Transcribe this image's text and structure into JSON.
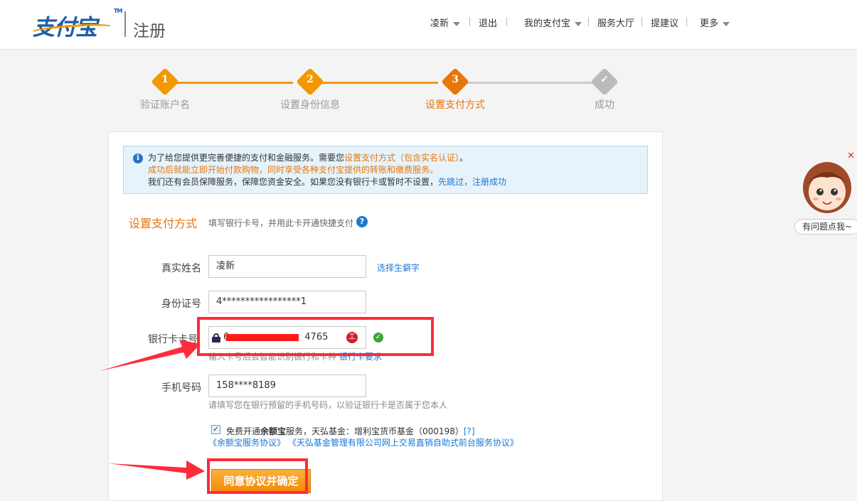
{
  "header": {
    "logo_text": "支付宝",
    "logo_tm": "TM",
    "page_title": "注册",
    "nav": [
      "凌新",
      "退出",
      "我的支付宝",
      "服务大厅",
      "提建议",
      "更多"
    ]
  },
  "steps": [
    {
      "num": "1",
      "label": "验证账户名",
      "state": "done"
    },
    {
      "num": "2",
      "label": "设置身份信息",
      "state": "done"
    },
    {
      "num": "3",
      "label": "设置支付方式",
      "state": "current"
    },
    {
      "num": "✓",
      "label": "成功",
      "state": "todo"
    }
  ],
  "notice": {
    "line1_prefix": "为了给您提供更完善便捷的支付和金融服务。需要您",
    "line1_highlight": "设置支付方式（包含实名认证）",
    "line1_suffix": "。",
    "line2": "成功后就能立即开始付款购物，同时享受各种支付宝提供的转账和缴费服务。",
    "line3_prefix": "我们还有会员保障服务，保障您资金安全。如果您没有银行卡或暂时不设置，",
    "line3_link": "先跳过，注册成功"
  },
  "section": {
    "title": "设置支付方式",
    "subtitle": "填写银行卡号，并用此卡开通快捷支付",
    "help_icon": "?"
  },
  "form": {
    "name_label": "真实姓名",
    "name_value": "凌新",
    "name_link": "选择生僻字",
    "id_label": "身份证号",
    "id_value": "4*****************1",
    "card_label": "银行卡卡号",
    "card_value_prefix": "6",
    "card_value_suffix": "4765",
    "bank_icon": "工",
    "card_hint": "输入卡号后会智能识别银行和卡种",
    "card_hint_link": "银行卡要求",
    "phone_label": "手机号码",
    "phone_value": "158****8189",
    "phone_hint": "请填写您在银行预留的手机号码，以验证银行卡是否属于您本人",
    "yuebao_checked": "✓",
    "yuebao_text_pre": "免费开通",
    "yuebao_bold": "余额宝",
    "yuebao_text_post": "服务，天弘基金：增利宝货币基金（000198）",
    "yuebao_help": "[?]",
    "agreement_links": "《余额宝服务协议》 《天弘基金管理有限公司网上交易直销自助式前台服务协议》",
    "submit_label": "同意协议并确定"
  },
  "helper": {
    "bubble": "有问题点我~",
    "close": "✕"
  },
  "colors": {
    "accent": "#f39800",
    "link": "#1976d2",
    "annotation": "#ff2a3a"
  }
}
